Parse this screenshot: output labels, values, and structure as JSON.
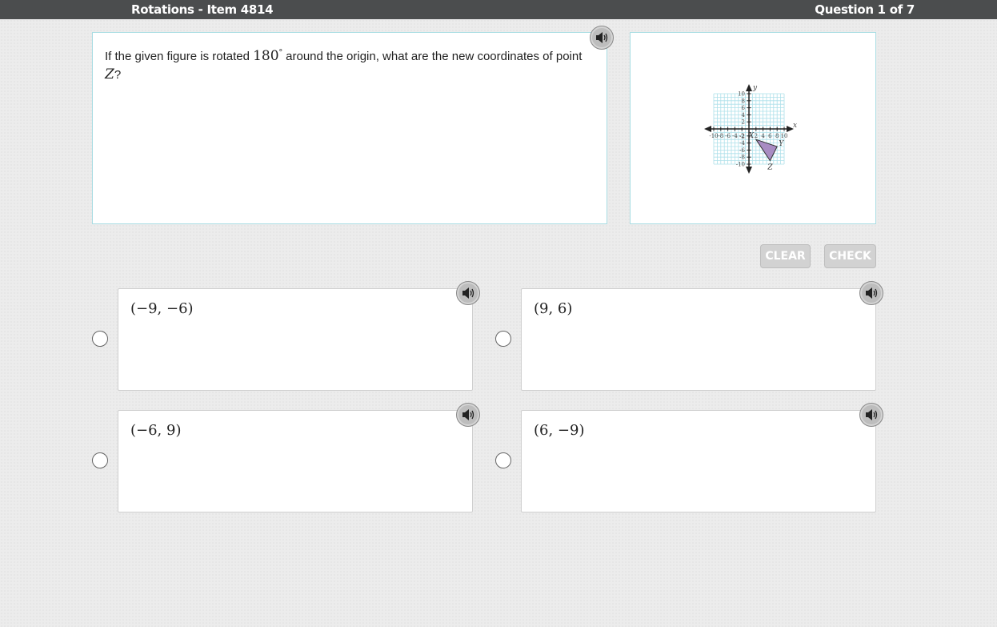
{
  "header": {
    "title": "Rotations - Item 4814",
    "question_count": "Question 1 of 7"
  },
  "question": {
    "text_part1": "If the given figure is rotated ",
    "angle": "180",
    "degree": "°",
    "text_part2": " around the origin, what are the new coordinates of point ",
    "point": "Z",
    "text_part3": "?"
  },
  "figure": {
    "x_axis_label": "x",
    "y_axis_label": "y",
    "x_ticks": [
      "-10",
      "-8",
      "-6",
      "-4",
      "-2",
      "2",
      "4",
      "6",
      "8",
      "10"
    ],
    "y_ticks": [
      "10",
      "8",
      "6",
      "4",
      "2",
      "-2",
      "-4",
      "-6",
      "-8",
      "-10"
    ],
    "vertex_labels": [
      "X",
      "Y",
      "Z"
    ],
    "triangle_color": "#a98cc3"
  },
  "buttons": {
    "clear_label": "CLEAR",
    "check_label": "CHECK"
  },
  "choices": [
    {
      "label": "(−9, −6)"
    },
    {
      "label": "(9, 6)"
    },
    {
      "label": "(−6, 9)"
    },
    {
      "label": "(6, −9)"
    }
  ]
}
